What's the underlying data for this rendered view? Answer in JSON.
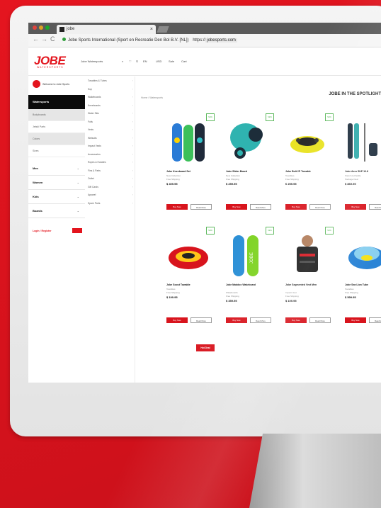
{
  "browser": {
    "tab_title": "jobe",
    "tab_close": "×",
    "back": "←",
    "forward": "→",
    "reload": "C",
    "url_owner": "Jobe Sports International (Sport en Recreatie Den Bol B.V. [NL])",
    "url_prefix": "https://",
    "url_domain": "jobesports.com"
  },
  "header": {
    "logo": "JOBE",
    "logo_sub": "WATERSPORTS",
    "menu": [
      "Jobe Watersports",
      "⌕",
      "♡",
      "⚲",
      "EN",
      "USD",
      "Sale",
      "Cart"
    ]
  },
  "left_column": {
    "account_text": "Welcome to Jobe Sports",
    "active_section": "Watersports",
    "items": [
      "Bodyboards",
      "Jetski Parts",
      "Colors",
      "Sizes"
    ],
    "sections": [
      "Men",
      "Women",
      "Kids",
      "Boards"
    ],
    "login": "Login / Register"
  },
  "categories": [
    "Towables & Tubes",
    "Sup",
    "Wakeboards",
    "Kneeboards",
    "Water Skis",
    "Foils",
    "Vests",
    "Wetsuits",
    "Impact Vests",
    "Accessories",
    "Ropes & Handles",
    "Fins & Parts",
    "Outlet",
    "Gift Cards",
    "Apparel",
    "Spare Parts"
  ],
  "main": {
    "breadcrumb": "Home / Watersports",
    "brand_title": "JOBE IN THE SPOTLIGHT",
    "hot_label": "Hot Deal",
    "buy_label": "Buy Now",
    "more_label": "Read More"
  },
  "products": [
    {
      "name": "Jobe Kneeboard Set",
      "meta1": "New Collection",
      "meta2": "Free Shipping",
      "price": "$ 409.95",
      "badge": "NEW"
    },
    {
      "name": "Jobe Slider Board",
      "meta1": "New Collection",
      "meta2": "Free Shipping",
      "price": "$ 259.95",
      "badge": "NEW"
    },
    {
      "name": "Jobe Bolt 2P Towable",
      "meta1": "Towables",
      "meta2": "Free Shipping",
      "price": "€ 259.95",
      "badge": "NEW"
    },
    {
      "name": "Jobe Aero SUP 10.6",
      "meta1": "Stand Up Paddle",
      "meta2": "Package Deal",
      "price": "$ 869.95",
      "badge": "NEW"
    },
    {
      "name": "Jobe Scout Towable",
      "meta1": "Towables",
      "meta2": "Free Shipping",
      "price": "$ 199.95",
      "badge": "NEW"
    },
    {
      "name": "Jobe Maddox Wakeboard",
      "meta1": "Wakeboards",
      "meta2": "Free Shipping",
      "price": "$ 359.95",
      "badge": "NEW"
    },
    {
      "name": "Jobe Segmented Vest Men",
      "meta1": "Impact Vest",
      "meta2": "Free Shipping",
      "price": "$ 109.95",
      "badge": "NEW"
    },
    {
      "name": "Jobe Sea Lion Tube",
      "meta1": "Towables",
      "meta2": "Free Shipping",
      "price": "$ 599.95",
      "badge": "NEW"
    }
  ],
  "colors": {
    "brand_red": "#e3141d",
    "badge_green": "#5cb85c"
  }
}
